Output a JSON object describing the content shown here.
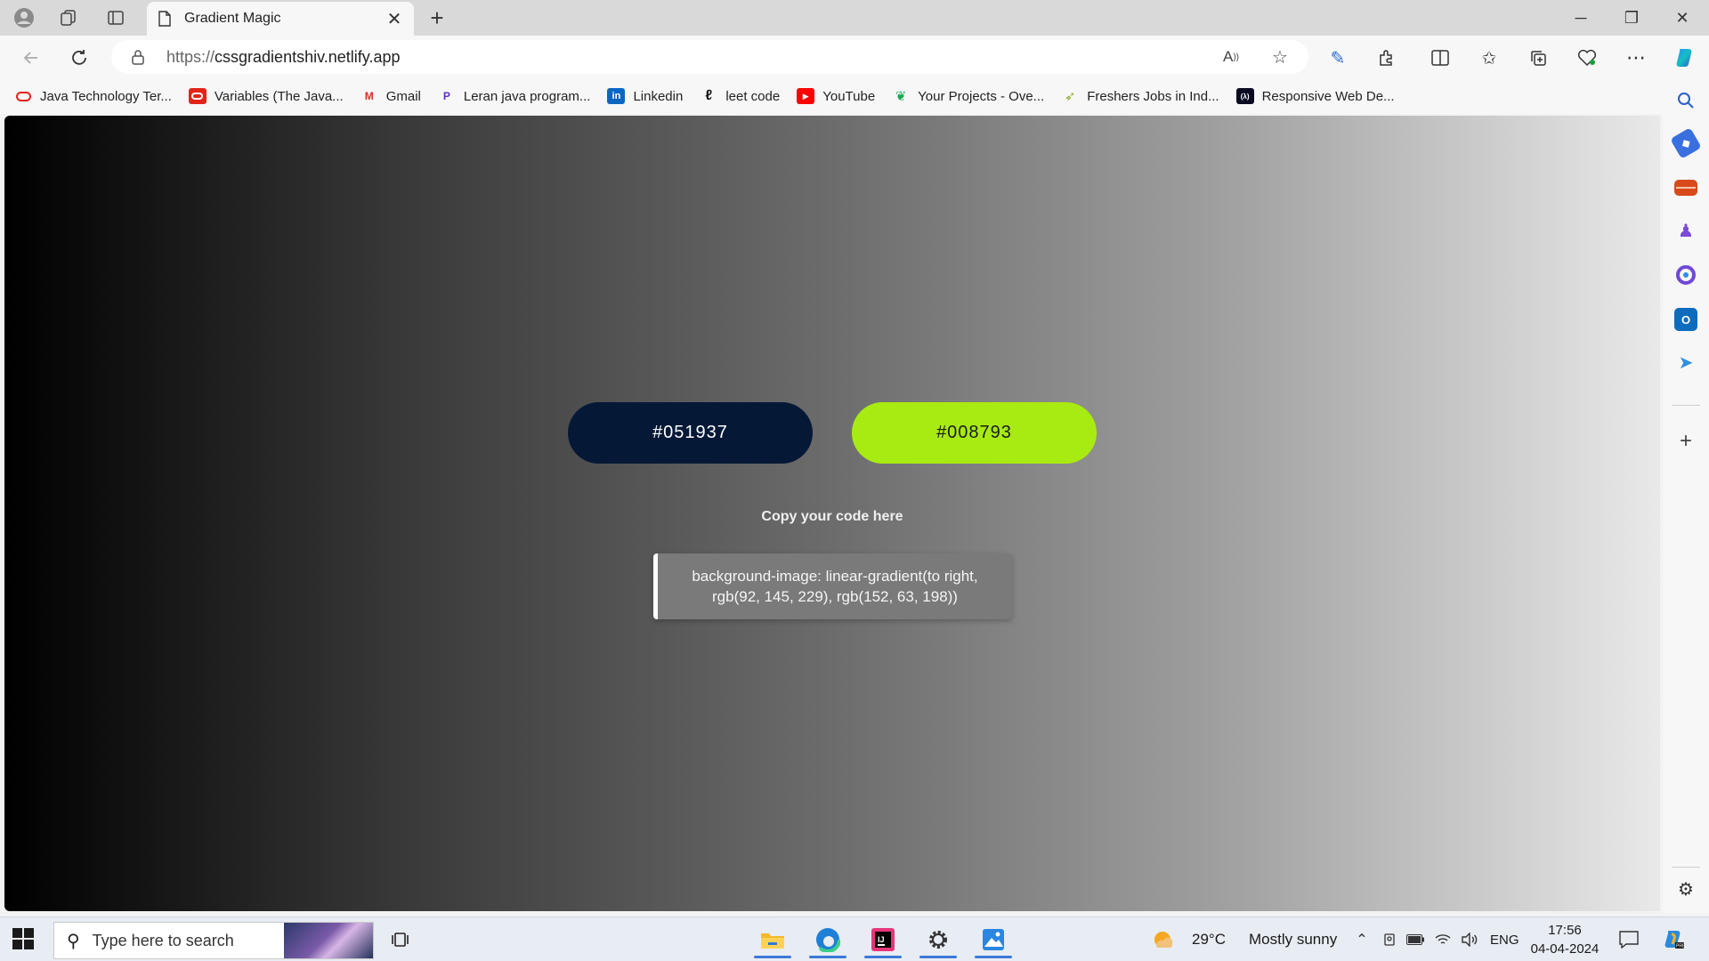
{
  "browser": {
    "tab": {
      "title": "Gradient Magic",
      "close_glyph": "✕"
    },
    "new_tab_glyph": "+",
    "window_controls": {
      "minimize": "─",
      "restore": "❐",
      "close": "✕"
    },
    "address": {
      "protocol": "https://",
      "host": "cssgradientshiv.netlify.app"
    },
    "favorites": [
      {
        "label": "Java Technology Ter...",
        "icon": "oracle-icon",
        "icon_glyph": "",
        "icon_color": "#e2231a"
      },
      {
        "label": "Variables (The Java...",
        "icon": "oracle-icon",
        "icon_glyph": "",
        "icon_color": "#e2231a"
      },
      {
        "label": "Gmail",
        "icon": "gmail-icon",
        "icon_glyph": "M",
        "icon_color": "#d93025"
      },
      {
        "label": "Leran java program...",
        "icon": "programiz-icon",
        "icon_glyph": "P",
        "icon_color": "#5b2ecf"
      },
      {
        "label": "Linkedin",
        "icon": "linkedin-icon",
        "icon_glyph": "in",
        "icon_color": "#0a66c2"
      },
      {
        "label": "leet code",
        "icon": "leetcode-icon",
        "icon_glyph": "ℓ",
        "icon_color": "#1a1a1a"
      },
      {
        "label": "YouTube",
        "icon": "youtube-icon",
        "icon_glyph": "▶",
        "icon_color": "#ff0000"
      },
      {
        "label": "Your Projects - Ove...",
        "icon": "mongodb-icon",
        "icon_glyph": "❦",
        "icon_color": "#13aa52"
      },
      {
        "label": "Freshers Jobs in Ind...",
        "icon": "freshers-icon",
        "icon_glyph": "➶",
        "icon_color": "#8bb12f"
      },
      {
        "label": "Responsive Web De...",
        "icon": "freecodecamp-icon",
        "icon_glyph": "(λ)",
        "icon_color": "#0a0a23"
      }
    ]
  },
  "page": {
    "color1": {
      "label": "#051937",
      "bg": "#051937"
    },
    "color2": {
      "label": "#008793",
      "bg": "#a8eb12"
    },
    "copy_label": "Copy your code here",
    "code_line1": "background-image: linear-gradient(to right,",
    "code_line2": "rgb(92, 145, 229), rgb(152, 63, 198))"
  },
  "taskbar": {
    "search_placeholder": "Type here to search",
    "weather_temp": "29°C",
    "weather_desc": "Mostly sunny",
    "lang": "ENG",
    "time": "17:56",
    "date": "04-04-2024"
  }
}
